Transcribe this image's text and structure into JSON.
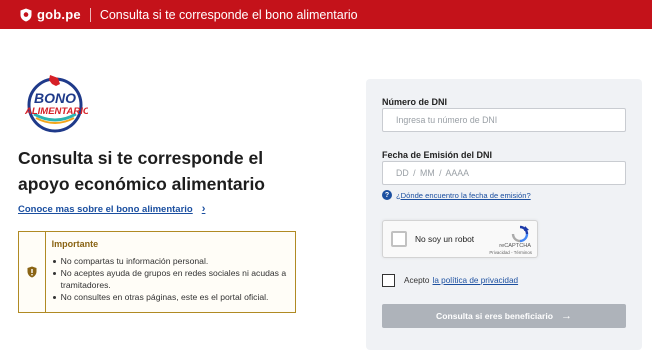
{
  "header": {
    "brand": "gob.pe",
    "title": "Consulta si te corresponde el bono alimentario",
    "color": "#c4121a"
  },
  "logo": {
    "line1": "BONO",
    "line2": "ALIMENTARIO"
  },
  "main": {
    "heading_line1": "Consulta si te corresponde el",
    "heading_line2": "apoyo económico alimentario",
    "more_link": "Conoce mas sobre el bono alimentario"
  },
  "notice": {
    "title": "Importante",
    "items": [
      "No compartas tu información personal.",
      "No aceptes ayuda de grupos en redes sociales ni acudas a tramitadores.",
      "No consultes en otras páginas, este es el portal oficial."
    ]
  },
  "form": {
    "dni_label": "Número de DNI",
    "dni_placeholder": "Ingresa tu número de DNI",
    "date_label": "Fecha de Emisión del DNI",
    "date_placeholder": "DD / MM / AAAA",
    "help_link": "¿Dónde encuentro la fecha de emisión?",
    "captcha_label": "No soy un robot",
    "captcha_brand": "reCAPTCHA",
    "captcha_terms": "Privacidad - Términos",
    "privacy_prefix": "Acepto",
    "privacy_link": "la política de privacidad",
    "submit_label": "Consulta si eres beneficiario"
  }
}
